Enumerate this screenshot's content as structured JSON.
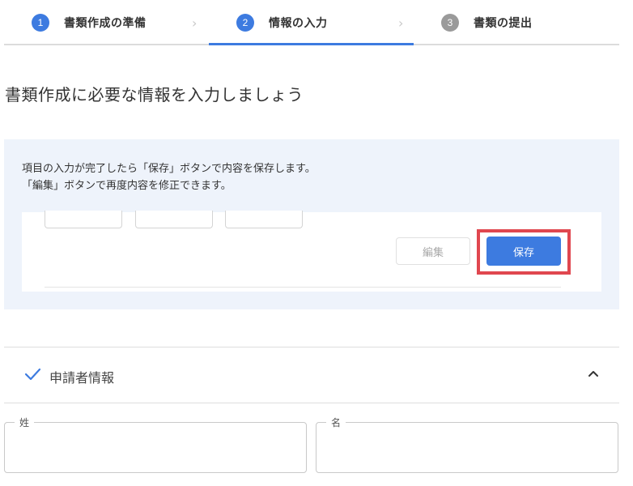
{
  "stepper": {
    "steps": [
      {
        "number": "1",
        "label": "書類作成の準備",
        "state": "active"
      },
      {
        "number": "2",
        "label": "情報の入力",
        "state": "current"
      },
      {
        "number": "3",
        "label": "書類の提出",
        "state": "upcoming"
      }
    ],
    "separator_icon": "chevron-right-icon"
  },
  "heading": "書類作成に必要な情報を入力しましょう",
  "info": {
    "line1": "項目の入力が完了したら「保存」ボタンで内容を保存します。",
    "line2": "「編集」ボタンで再度内容を修正できます。",
    "demo": {
      "edit_label": "編集",
      "save_label": "保存"
    }
  },
  "section": {
    "title": "申請者情報",
    "check_icon": "check-icon",
    "toggle_icon": "chevron-up-icon"
  },
  "fields": {
    "last_name_label": "姓",
    "first_name_label": "名"
  },
  "colors": {
    "accent": "#3d7be0",
    "highlight": "#e0474f",
    "panel_bg": "#eef3fb"
  }
}
